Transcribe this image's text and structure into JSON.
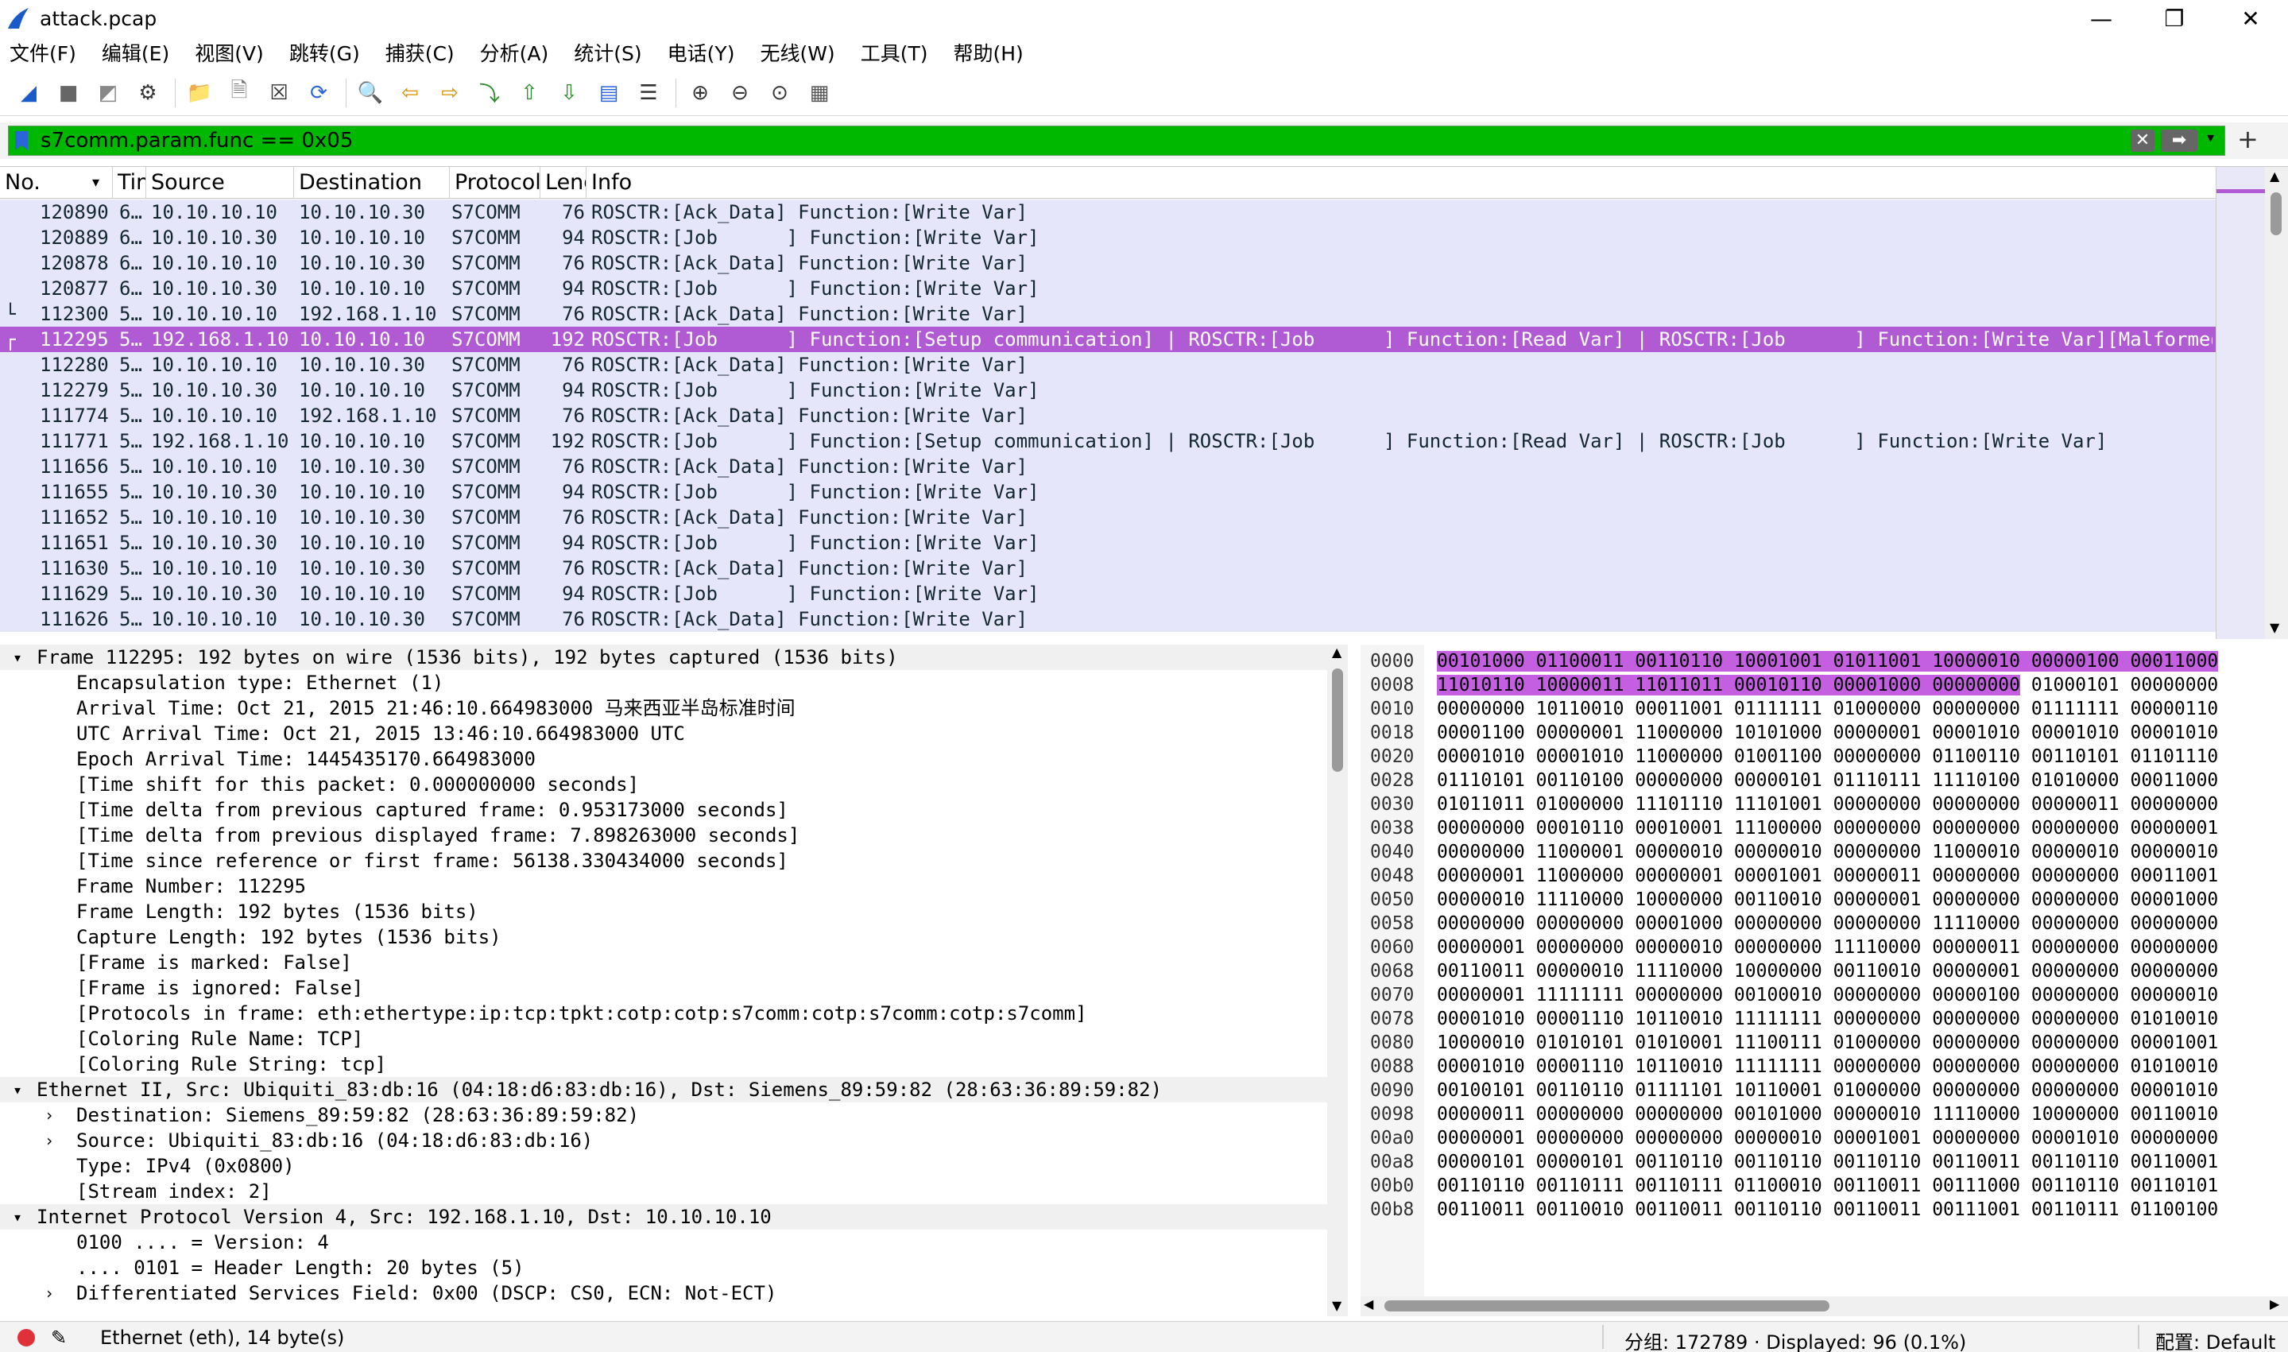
{
  "window": {
    "title": "attack.pcap",
    "minimize_glyph": "—",
    "maximize_glyph": "❐",
    "close_glyph": "✕"
  },
  "menu": [
    "文件(F)",
    "编辑(E)",
    "视图(V)",
    "跳转(G)",
    "捕获(C)",
    "分析(A)",
    "统计(S)",
    "电话(Y)",
    "无线(W)",
    "工具(T)",
    "帮助(H)"
  ],
  "toolbar_icons": [
    "shark-fin-start-icon",
    "stop-icon",
    "restart-icon",
    "capture-options-icon",
    "open-folder-icon",
    "save-file-icon",
    "close-file-icon",
    "reload-icon",
    "find-icon",
    "go-back-icon",
    "go-forward-icon",
    "go-to-packet-icon",
    "first-packet-icon",
    "last-packet-icon",
    "auto-scroll-icon",
    "colorize-icon",
    "zoom-in-icon",
    "zoom-out-icon",
    "normal-size-icon",
    "resize-columns-icon"
  ],
  "filter": {
    "value": "s7comm.param.func == 0x05",
    "clear_glyph": "✕",
    "apply_glyph": "➡",
    "dropdown_glyph": "▾",
    "add_glyph": "+"
  },
  "packet_list": {
    "columns": [
      "No.",
      "Tin",
      "Source",
      "Destination",
      "Protocol",
      "Leng",
      "Info"
    ],
    "rows": [
      {
        "no": "120890",
        "time": "6…",
        "src": "10.10.10.10",
        "dst": "10.10.10.30",
        "proto": "S7COMM",
        "len": "76",
        "info": "ROSCTR:[Ack_Data] Function:[Write Var]"
      },
      {
        "no": "120889",
        "time": "6…",
        "src": "10.10.10.30",
        "dst": "10.10.10.10",
        "proto": "S7COMM",
        "len": "94",
        "info": "ROSCTR:[Job      ] Function:[Write Var]"
      },
      {
        "no": "120878",
        "time": "6…",
        "src": "10.10.10.10",
        "dst": "10.10.10.30",
        "proto": "S7COMM",
        "len": "76",
        "info": "ROSCTR:[Ack_Data] Function:[Write Var]"
      },
      {
        "no": "120877",
        "time": "6…",
        "src": "10.10.10.30",
        "dst": "10.10.10.10",
        "proto": "S7COMM",
        "len": "94",
        "info": "ROSCTR:[Job      ] Function:[Write Var]"
      },
      {
        "no": "112300",
        "time": "5…",
        "src": "10.10.10.10",
        "dst": "192.168.1.10",
        "proto": "S7COMM",
        "len": "76",
        "info": "ROSCTR:[Ack_Data] Function:[Write Var]",
        "marker": "└"
      },
      {
        "no": "112295",
        "time": "5…",
        "src": "192.168.1.10",
        "dst": "10.10.10.10",
        "proto": "S7COMM",
        "len": "192",
        "info": "ROSCTR:[Job      ] Function:[Setup communication] | ROSCTR:[Job      ] Function:[Read Var] | ROSCTR:[Job      ] Function:[Write Var][Malformed P…",
        "marker": "┌",
        "selected": true
      },
      {
        "no": "112280",
        "time": "5…",
        "src": "10.10.10.10",
        "dst": "10.10.10.30",
        "proto": "S7COMM",
        "len": "76",
        "info": "ROSCTR:[Ack_Data] Function:[Write Var]"
      },
      {
        "no": "112279",
        "time": "5…",
        "src": "10.10.10.30",
        "dst": "10.10.10.10",
        "proto": "S7COMM",
        "len": "94",
        "info": "ROSCTR:[Job      ] Function:[Write Var]"
      },
      {
        "no": "111774",
        "time": "5…",
        "src": "10.10.10.10",
        "dst": "192.168.1.10",
        "proto": "S7COMM",
        "len": "76",
        "info": "ROSCTR:[Ack_Data] Function:[Write Var]"
      },
      {
        "no": "111771",
        "time": "5…",
        "src": "192.168.1.10",
        "dst": "10.10.10.10",
        "proto": "S7COMM",
        "len": "192",
        "info": "ROSCTR:[Job      ] Function:[Setup communication] | ROSCTR:[Job      ] Function:[Read Var] | ROSCTR:[Job      ] Function:[Write Var]"
      },
      {
        "no": "111656",
        "time": "5…",
        "src": "10.10.10.10",
        "dst": "10.10.10.30",
        "proto": "S7COMM",
        "len": "76",
        "info": "ROSCTR:[Ack_Data] Function:[Write Var]"
      },
      {
        "no": "111655",
        "time": "5…",
        "src": "10.10.10.30",
        "dst": "10.10.10.10",
        "proto": "S7COMM",
        "len": "94",
        "info": "ROSCTR:[Job      ] Function:[Write Var]"
      },
      {
        "no": "111652",
        "time": "5…",
        "src": "10.10.10.10",
        "dst": "10.10.10.30",
        "proto": "S7COMM",
        "len": "76",
        "info": "ROSCTR:[Ack_Data] Function:[Write Var]"
      },
      {
        "no": "111651",
        "time": "5…",
        "src": "10.10.10.30",
        "dst": "10.10.10.10",
        "proto": "S7COMM",
        "len": "94",
        "info": "ROSCTR:[Job      ] Function:[Write Var]"
      },
      {
        "no": "111630",
        "time": "5…",
        "src": "10.10.10.10",
        "dst": "10.10.10.30",
        "proto": "S7COMM",
        "len": "76",
        "info": "ROSCTR:[Ack_Data] Function:[Write Var]"
      },
      {
        "no": "111629",
        "time": "5…",
        "src": "10.10.10.30",
        "dst": "10.10.10.10",
        "proto": "S7COMM",
        "len": "94",
        "info": "ROSCTR:[Job      ] Function:[Write Var]"
      },
      {
        "no": "111626",
        "time": "5…",
        "src": "10.10.10.10",
        "dst": "10.10.10.30",
        "proto": "S7COMM",
        "len": "76",
        "info": "ROSCTR:[Ack_Data] Function:[Write Var]"
      }
    ]
  },
  "details": [
    {
      "level": 0,
      "arrow": "▾",
      "head": true,
      "text": "Frame 112295: 192 bytes on wire (1536 bits), 192 bytes captured (1536 bits)"
    },
    {
      "level": 1,
      "text": "Encapsulation type: Ethernet (1)"
    },
    {
      "level": 1,
      "text": "Arrival Time: Oct 21, 2015 21:46:10.664983000 马来西亚半岛标准时间"
    },
    {
      "level": 1,
      "text": "UTC Arrival Time: Oct 21, 2015 13:46:10.664983000 UTC"
    },
    {
      "level": 1,
      "text": "Epoch Arrival Time: 1445435170.664983000"
    },
    {
      "level": 1,
      "text": "[Time shift for this packet: 0.000000000 seconds]"
    },
    {
      "level": 1,
      "text": "[Time delta from previous captured frame: 0.953173000 seconds]"
    },
    {
      "level": 1,
      "text": "[Time delta from previous displayed frame: 7.898263000 seconds]"
    },
    {
      "level": 1,
      "text": "[Time since reference or first frame: 56138.330434000 seconds]"
    },
    {
      "level": 1,
      "text": "Frame Number: 112295"
    },
    {
      "level": 1,
      "text": "Frame Length: 192 bytes (1536 bits)"
    },
    {
      "level": 1,
      "text": "Capture Length: 192 bytes (1536 bits)"
    },
    {
      "level": 1,
      "text": "[Frame is marked: False]"
    },
    {
      "level": 1,
      "text": "[Frame is ignored: False]"
    },
    {
      "level": 1,
      "text": "[Protocols in frame: eth:ethertype:ip:tcp:tpkt:cotp:cotp:s7comm:cotp:s7comm:cotp:s7comm]"
    },
    {
      "level": 1,
      "text": "[Coloring Rule Name: TCP]"
    },
    {
      "level": 1,
      "text": "[Coloring Rule String: tcp]"
    },
    {
      "level": 0,
      "arrow": "▾",
      "head": true,
      "text": "Ethernet II, Src: Ubiquiti_83:db:16 (04:18:d6:83:db:16), Dst: Siemens_89:59:82 (28:63:36:89:59:82)"
    },
    {
      "level": 1,
      "arrow": "›",
      "text": "Destination: Siemens_89:59:82 (28:63:36:89:59:82)"
    },
    {
      "level": 1,
      "arrow": "›",
      "text": "Source: Ubiquiti_83:db:16 (04:18:d6:83:db:16)"
    },
    {
      "level": 1,
      "text": "Type: IPv4 (0x0800)"
    },
    {
      "level": 1,
      "text": "[Stream index: 2]"
    },
    {
      "level": 0,
      "arrow": "▾",
      "head": true,
      "text": "Internet Protocol Version 4, Src: 192.168.1.10, Dst: 10.10.10.10"
    },
    {
      "level": 1,
      "text": "0100 .... = Version: 4"
    },
    {
      "level": 1,
      "text": ".... 0101 = Header Length: 20 bytes (5)"
    },
    {
      "level": 1,
      "arrow": "›",
      "text": "Differentiated Services Field: 0x00 (DSCP: CS0, ECN: Not-ECT)"
    }
  ],
  "bytes": {
    "offsets": [
      "0000",
      "0008",
      "0010",
      "0018",
      "0020",
      "0028",
      "0030",
      "0038",
      "0040",
      "0048",
      "0050",
      "0058",
      "0060",
      "0068",
      "0070",
      "0078",
      "0080",
      "0088",
      "0090",
      "0098",
      "00a0",
      "00a8",
      "00b0",
      "00b8"
    ],
    "rows": [
      "00101000 01100011 00110110 10001001 01011001 10000010 00000100 00011000",
      "11010110 10000011 11011011 00010110 00001000 00000000 01000101 00000000",
      "00000000 10110010 00011001 01111111 01000000 00000000 01111111 00000110",
      "00001100 00000001 11000000 10101000 00000001 00001010 00001010 00001010",
      "00001010 00001010 11000000 01001100 00000000 01100110 00110101 01101110",
      "01110101 00110100 00000000 00000101 01110111 11110100 01010000 00011000",
      "01011011 01000000 11101110 11101001 00000000 00000000 00000011 00000000",
      "00000000 00010110 00010001 11100000 00000000 00000000 00000000 00000001",
      "00000000 11000001 00000010 00000010 00000000 11000010 00000010 00000010",
      "00000001 11000000 00000001 00001001 00000011 00000000 00000000 00011001",
      "00000010 11110000 10000000 00110010 00000001 00000000 00000000 00001000",
      "00000000 00000000 00001000 00000000 00000000 11110000 00000000 00000000",
      "00000001 00000000 00000010 00000000 11110000 00000011 00000000 00000000",
      "00110011 00000010 11110000 10000000 00110010 00000001 00000000 00000000",
      "00000001 11111111 00000000 00100010 00000000 00000100 00000000 00000010",
      "00001010 00001110 10110010 11111111 00000000 00000000 00000000 01010010",
      "10000010 01010101 01010001 11100111 01000000 00000000 00000000 00001001",
      "00001010 00001110 10110010 11111111 00000000 00000000 00000000 01010010",
      "00100101 00110110 01111101 10110001 01000000 00000000 00000000 00001010",
      "00000011 00000000 00000000 00101000 00000010 11110000 10000000 00110010",
      "00000001 00000000 00000000 00000010 00001001 00000000 00001010 00000000",
      "00000101 00000101 00110110 00110110 00110110 00110011 00110110 00110001",
      "00110110 00110111 00110111 01100010 00110011 00111000 00110110 00110101",
      "00110011 00110010 00110011 00110110 00110011 00111001 00110111 01100100"
    ],
    "highlight_bytes": 14
  },
  "status": {
    "left": "Ethernet (eth), 14 byte(s)",
    "packets": "分组: 172789 · Displayed: 96 (0.1%)",
    "profile": "配置: Default"
  },
  "colors": {
    "row_bg": "#e6e6fa",
    "selected_bg": "#b05ad4",
    "filter_valid": "#00b800",
    "byte_highlight": "#c35fe0"
  }
}
